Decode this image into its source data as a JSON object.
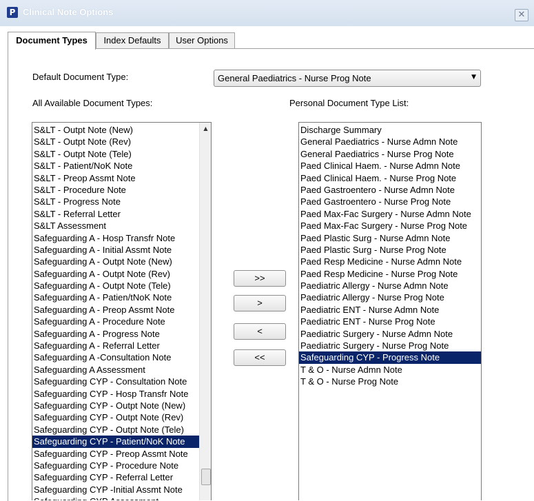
{
  "window": {
    "title": "Clinical Note Options",
    "app_icon": "P",
    "close_glyph": "✕"
  },
  "tabs": [
    {
      "label": "Document Types",
      "active": true
    },
    {
      "label": "Index Defaults",
      "active": false
    },
    {
      "label": "User Options",
      "active": false
    }
  ],
  "default_type": {
    "label": "Default Document Type:",
    "value": "General Paediatrics - Nurse Prog Note"
  },
  "available": {
    "label": "All Available Document Types:",
    "items": [
      "S&LT  - Outpt Note (New)",
      "S&LT  - Outpt Note (Rev)",
      "S&LT  - Outpt Note (Tele)",
      "S&LT  - Patient/NoK Note",
      "S&LT  - Preop Assmt Note",
      "S&LT  - Procedure Note",
      "S&LT  - Progress Note",
      "S&LT  - Referral Letter",
      "S&LT Assessment",
      "Safeguarding A  - Hosp Transfr Note",
      "Safeguarding A  - Initial Assmt Note",
      "Safeguarding A  - Outpt Note (New)",
      "Safeguarding A  - Outpt Note (Rev)",
      "Safeguarding A  - Outpt Note (Tele)",
      "Safeguarding A  - Patien/tNoK Note",
      "Safeguarding A  - Preop Assmt Note",
      "Safeguarding A  - Procedure Note",
      "Safeguarding A  - Progress Note",
      "Safeguarding A  - Referral Letter",
      "Safeguarding A  -Consultation Note",
      "Safeguarding A Assessment",
      "Safeguarding CYP  - Consultation Note",
      "Safeguarding CYP  - Hosp Transfr Note",
      "Safeguarding CYP  - Outpt Note (New)",
      "Safeguarding CYP  - Outpt Note (Rev)",
      "Safeguarding CYP  - Outpt Note (Tele)",
      "Safeguarding CYP  - Patient/NoK Note",
      "Safeguarding CYP  - Preop Assmt Note",
      "Safeguarding CYP  - Procedure Note",
      "Safeguarding CYP  - Referral Letter",
      "Safeguarding CYP  -Initial Assmt Note",
      "Safeguarding CYP Assessment"
    ],
    "selected_index": 26
  },
  "buttons": {
    "add_all": ">>",
    "add_one": ">",
    "remove_one": "<",
    "remove_all": "<<"
  },
  "personal": {
    "label": "Personal Document Type List:",
    "items": [
      "Discharge Summary",
      "General Paediatrics - Nurse Admn Note",
      "General Paediatrics - Nurse Prog Note",
      "Paed Clinical Haem. - Nurse Admn Note",
      "Paed Clinical Haem. - Nurse Prog Note",
      "Paed Gastroentero - Nurse Admn Note",
      "Paed Gastroentero - Nurse Prog Note",
      "Paed Max-Fac Surgery - Nurse Admn Note",
      "Paed Max-Fac Surgery - Nurse Prog Note",
      "Paed Plastic Surg - Nurse Admn Note",
      "Paed Plastic Surg - Nurse Prog Note",
      "Paed Resp Medicine - Nurse Admn Note",
      "Paed Resp Medicine - Nurse Prog Note",
      "Paediatric Allergy - Nurse Admn Note",
      "Paediatric Allergy - Nurse Prog Note",
      "Paediatric ENT - Nurse Admn Note",
      "Paediatric ENT - Nurse Prog Note",
      "Paediatric Surgery - Nurse Admn Note",
      "Paediatric Surgery - Nurse Prog Note",
      "Safeguarding CYP  - Progress Note",
      "T & O - Nurse Admn Note",
      "T & O - Nurse Prog Note"
    ],
    "selected_index": 19
  }
}
